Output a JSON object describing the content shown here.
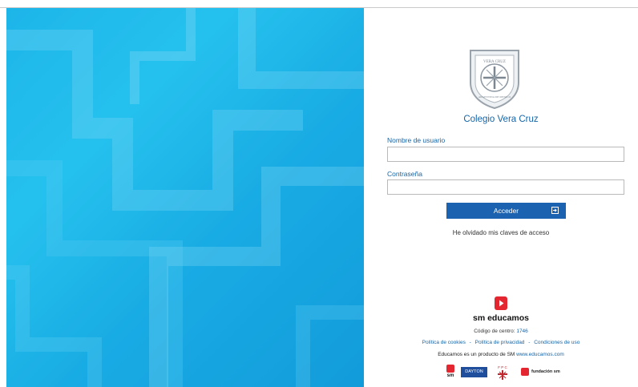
{
  "school": {
    "name": "Colegio Vera Cruz",
    "crest_text_top": "VERA CRUZ",
    "crest_text_bottom": "ARGENTINA DE MEXICO"
  },
  "form": {
    "username_label": "Nombre de usuario",
    "username_value": "",
    "password_label": "Contraseña",
    "password_value": "",
    "submit_label": "Acceder",
    "forgot_label": "He olvidado mis claves de acceso"
  },
  "footer": {
    "brand": "sm educamos",
    "center_code_label": "Código de centro:",
    "center_code_value": "1746",
    "links": [
      "Política de cookies",
      "Política de privacidad",
      "Condiciones de uso"
    ],
    "link_separator": "-",
    "product_text": "Educamos es un producto de SM",
    "product_url_text": "www.educamos.com",
    "partners": {
      "sm": "sm",
      "dayton": "DAYTON",
      "fpc": "F P C",
      "fundacion": "fundación sm"
    }
  },
  "colors": {
    "primary": "#1b63b0",
    "link": "#1565a8",
    "brand_red": "#e3262f",
    "background_blue": "#1fb9ec"
  },
  "icons": {
    "submit": "login-arrow-icon",
    "brand": "play-logo-icon",
    "crest": "school-crest-icon"
  }
}
